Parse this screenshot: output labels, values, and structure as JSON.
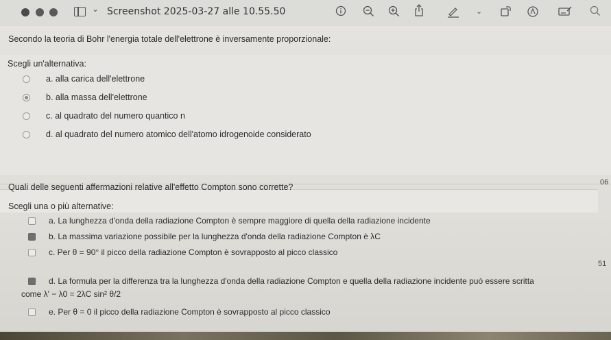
{
  "window": {
    "title": "Screenshot 2025-03-27 alle 10.55.50"
  },
  "question1": {
    "prompt": "Secondo la teoria di Bohr l'energia totale dell'elettrone è inversamente proporzionale:",
    "instruction": "Scegli un'alternativa:",
    "options": [
      {
        "label": "a. alla carica dell'elettrone",
        "selected": false
      },
      {
        "label": "b. alla massa dell'elettrone",
        "selected": true
      },
      {
        "label": "c. al quadrato del numero quantico n",
        "selected": false
      },
      {
        "label": "d. al quadrato del numero atomico dell'atomo idrogenoide considerato",
        "selected": false
      }
    ]
  },
  "question2": {
    "prompt": "Quali delle seguenti affermazioni relative all'effetto Compton sono corrette?",
    "instruction": "Scegli una o più alternative:",
    "options": [
      {
        "label": "a. La lunghezza d'onda della radiazione Compton è sempre maggiore di quella della radiazione incidente",
        "checked": false
      },
      {
        "label": "b. La massima variazione possibile per la lunghezza d'onda della radiazione Compton è λC",
        "checked": true
      },
      {
        "label": "c. Per θ = 90° il picco della radiazione Compton è sovrapposto al picco classico",
        "checked": false
      },
      {
        "label": "d. La formula per la differenza tra la lunghezza d'onda della radiazione Compton e quella della radiazione incidente può essere scritta",
        "label_cont": "come λ' − λ0 = 2λC sin² θ/2",
        "checked": true
      },
      {
        "label": "e. Per θ = 0 il picco della radiazione Compton è sovrapposto al picco classico",
        "checked": false
      }
    ]
  },
  "side_numbers": {
    "top": "06",
    "middle": "51"
  },
  "icons": [
    "sidebar-icon",
    "chevron-down-icon",
    "info-icon",
    "zoom-out-icon",
    "zoom-in-icon",
    "share-icon",
    "markup-pen-icon",
    "chevron-down-icon",
    "rotate-icon",
    "markup-icon",
    "fill-form-icon",
    "search-icon"
  ]
}
